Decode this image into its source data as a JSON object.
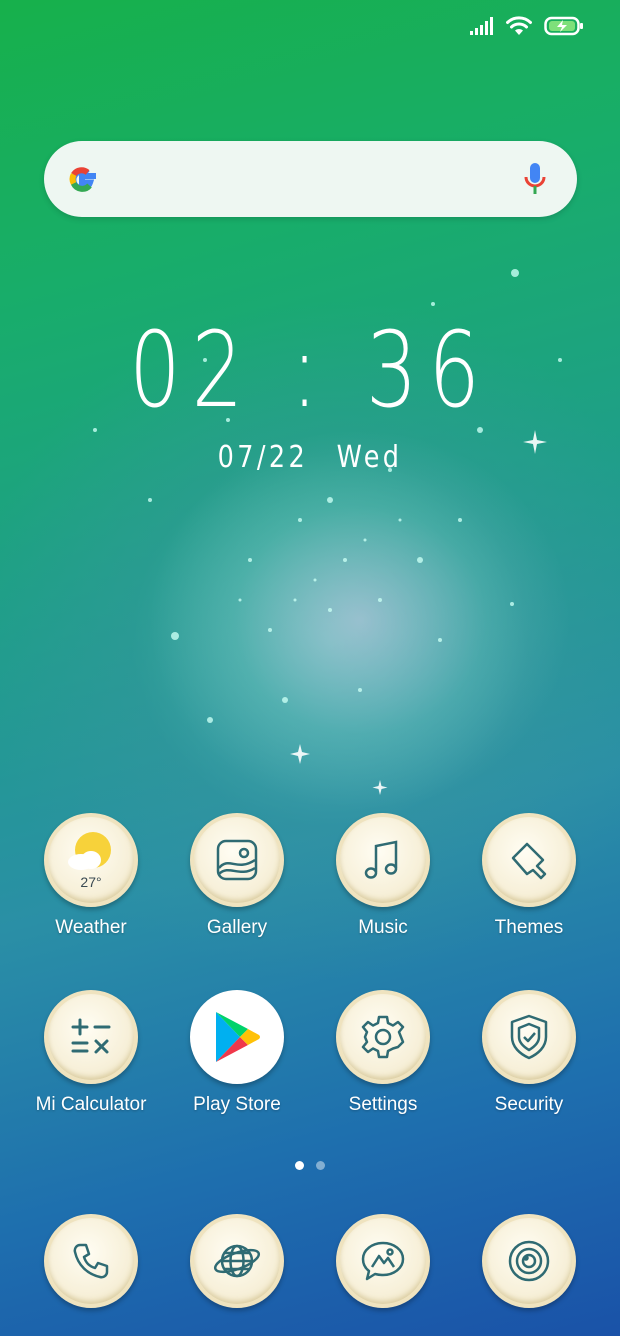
{
  "status_bar": {
    "icons": [
      "signal-icon",
      "wifi-icon",
      "battery-charging-icon"
    ],
    "colors": {
      "icon": "#ffffff",
      "battery": "#7ee07a"
    }
  },
  "search": {
    "icons": [
      "google-logo",
      "mic-icon"
    ]
  },
  "clock": {
    "time": "02 : 36",
    "date": "07/22",
    "day": "Wed"
  },
  "apps": [
    {
      "label": "Weather",
      "icon": "weather-icon",
      "temp": "27°"
    },
    {
      "label": "Gallery",
      "icon": "gallery-icon"
    },
    {
      "label": "Music",
      "icon": "music-icon"
    },
    {
      "label": "Themes",
      "icon": "themes-icon"
    },
    {
      "label": "Mi Calculator",
      "icon": "calculator-icon"
    },
    {
      "label": "Play Store",
      "icon": "play-store-icon"
    },
    {
      "label": "Settings",
      "icon": "gear-icon"
    },
    {
      "label": "Security",
      "icon": "shield-icon"
    }
  ],
  "page_indicator": {
    "pages": 2,
    "active": 1
  },
  "dock": [
    {
      "icon": "phone-icon"
    },
    {
      "icon": "browser-globe-icon"
    },
    {
      "icon": "messages-icon"
    },
    {
      "icon": "camera-icon"
    }
  ],
  "colors": {
    "icon_line": "#2f6b73",
    "icon_bg": "#f7f0d9",
    "sun": "#f7d23a"
  }
}
